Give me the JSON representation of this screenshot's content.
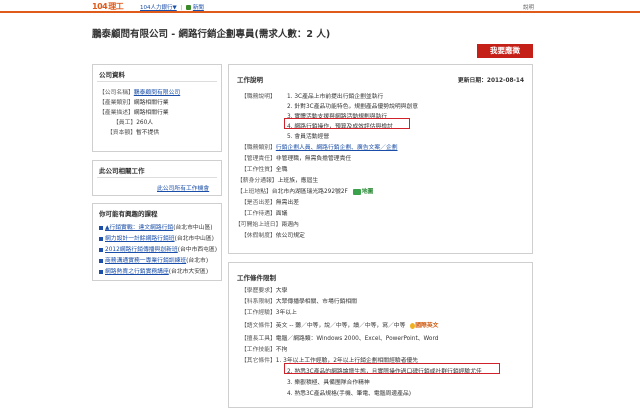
{
  "topbar": {
    "logo": "104",
    "logo_sub": "理工",
    "nav": [
      "104人力銀行▼",
      "新聞"
    ],
    "right_text": "說明"
  },
  "company_title": "鵬泰顧問有限公司 - 網路行銷企劃專員(需求人數：2 人)",
  "apply_button": "我要應徵",
  "company_info": {
    "heading": "公司資料",
    "rows": [
      {
        "k": "【公司名稱】",
        "v": "鵬泰顧問有限公司",
        "link": true
      },
      {
        "k": "【產業類別】",
        "v": "網路相關行業",
        "link": false
      },
      {
        "k": "【產業描述】",
        "v": "網路相關行業",
        "link": false
      },
      {
        "k": "【員工】",
        "v": "260人",
        "link": false
      },
      {
        "k": "【資本額】",
        "v": "暫不提供",
        "link": false
      }
    ]
  },
  "related_jobs": {
    "heading": "此公司相關工作",
    "link": "此公司所有工作機會"
  },
  "courses": {
    "heading": "你可能有興趣的課程",
    "items": [
      {
        "title": "▲行銷實戰：達文網路行銷",
        "loc": "(台北市中山區)"
      },
      {
        "title": "網力設計一計餘網路行銷班",
        "loc": "(台北市中山區)"
      },
      {
        "title": "2012網路行銷傳播與創新班",
        "loc": "(台中市西屯區)"
      },
      {
        "title": "商務溝通實務一專業行銷訓練班",
        "loc": "(台北市)"
      },
      {
        "title": "網路熱賣之行銷實務講座",
        "loc": "(台北市大安區)"
      }
    ]
  },
  "job_desc": {
    "heading": "工作說明",
    "updated": "更新日期：2012-08-14",
    "content_label": "【職務說明】",
    "content": [
      "1. 3C產品上市前提出行銷企劃並執行",
      "2. 針對3C產品功能特色，規劃產品優勢說明與創意",
      "3. 實體活動支援與網路活動規劃與執行",
      "4. 網路行銷操作，預算及成效評估與檢討",
      "5. 會員活動經營"
    ],
    "rows": [
      {
        "k": "【職務類別】",
        "v": "行銷企劃人員、網路行銷企劃、廣告文案／企劃",
        "link": true
      },
      {
        "k": "【管理責任】",
        "v": "非管理職，無需負擔管理責任",
        "link": false
      },
      {
        "k": "【工作性質】",
        "v": "全職",
        "link": false
      },
      {
        "k": "【薪身分通報】",
        "v": "上班族，應屆生",
        "link": false
      },
      {
        "k": "【上班地點】",
        "v": "台北市內湖區瑞光路292號2F",
        "link": false
      },
      {
        "k": "【是否出差】",
        "v": "無需出差",
        "link": false
      },
      {
        "k": "【工作待遇】",
        "v": "面議",
        "link": false
      },
      {
        "k": "【可開始上班日】",
        "v": "兩週內",
        "link": false
      },
      {
        "k": "【休假制度】",
        "v": "依公司規定",
        "link": false
      }
    ],
    "map_label": "地圖"
  },
  "job_req": {
    "heading": "工作條件限制",
    "rows": [
      {
        "k": "【學歷要求】",
        "v": "大學"
      },
      {
        "k": "【科系限制】",
        "v": "大眾傳播學相關、市場行銷相關"
      },
      {
        "k": "【工作經驗】",
        "v": "3年以上"
      },
      {
        "k": "【語文條件】",
        "v": "英文 -- 聽／中等，說／中等，讀／中等，寫／中等"
      },
      {
        "k": "【擅長工具】",
        "v": "電腦／網路類：Windows 2000、Excel、PowerPoint、Word"
      },
      {
        "k": "【工作技能】",
        "v": "不拘"
      },
      {
        "k": "【其它條件】",
        "v": "1. 3年以上工作經驗，2年以上行銷企劃相關經驗者優先"
      }
    ],
    "english_badge": "國際英文",
    "extra": [
      "2. 熟悉3C產品的網路論壇生態，且實際操作過口碑行銷或社群行銷經驗尤佳",
      "3. 樂觀積極、具備團隊合作精神",
      "4. 熟悉3C產品規格(手機、筆電、電腦周邊產品)"
    ]
  }
}
